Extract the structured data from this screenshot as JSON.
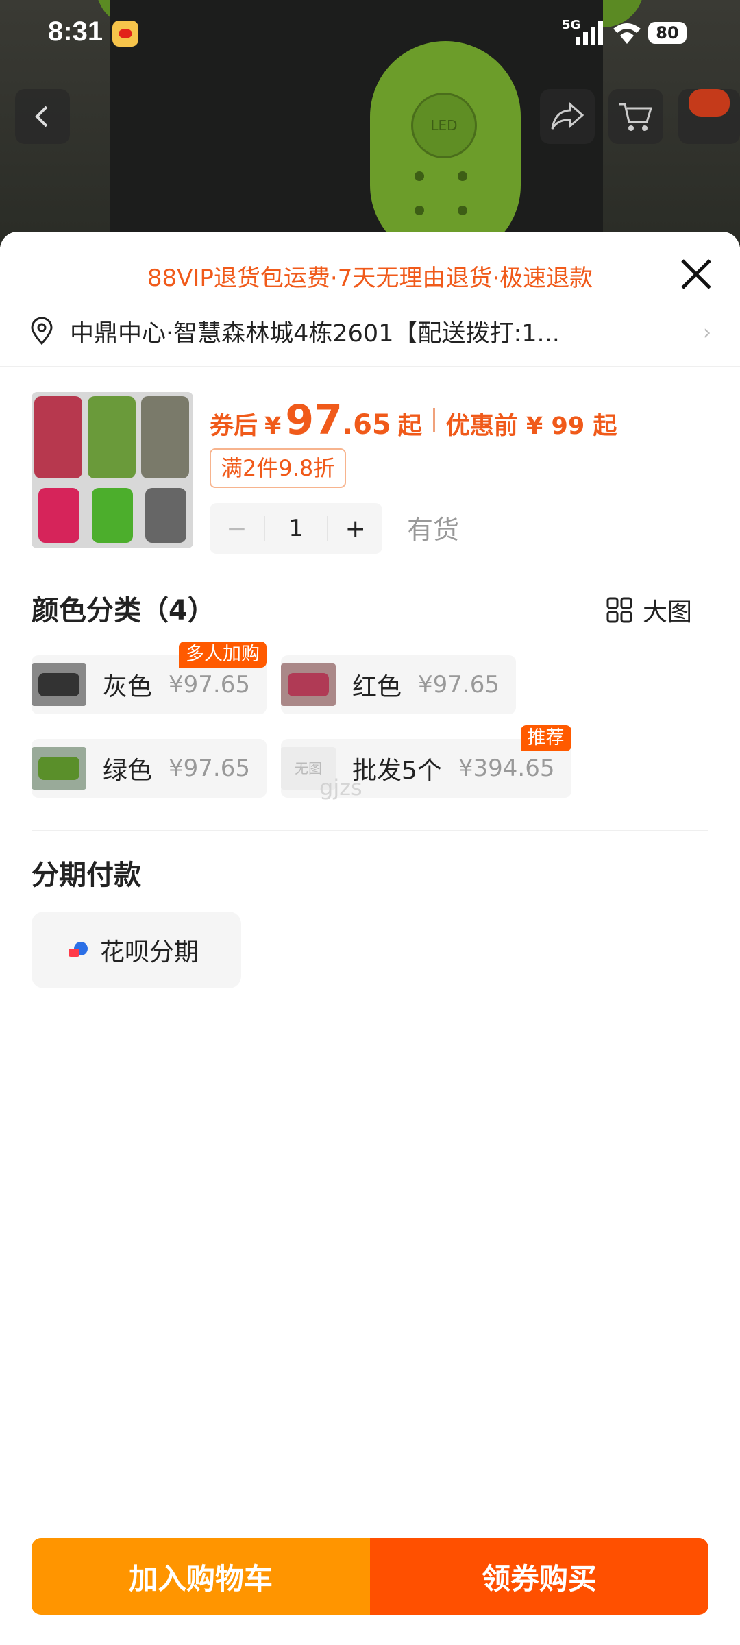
{
  "status_bar": {
    "time": "8:31",
    "network": "5G",
    "battery": "80"
  },
  "sheet": {
    "promo": "88VIP退货包运费·7天无理由退货·极速退款",
    "address": "中鼎中心·智慧森林城4栋2601【配送拨打:1...",
    "price": {
      "after_label": "券后",
      "currency": "¥",
      "after_int": "97",
      "after_dec": ".65",
      "suffix": "起",
      "before_text": "优惠前 ¥ 99 起"
    },
    "coupon": "满2件9.8折",
    "quantity": "1",
    "stock": "有货",
    "variants_title": "颜色分类（4）",
    "big_image": "大图",
    "variants": [
      {
        "name": "灰色",
        "price": "¥97.65",
        "badge": "多人加购"
      },
      {
        "name": "红色",
        "price": "¥97.65",
        "badge": ""
      },
      {
        "name": "绿色",
        "price": "¥97.65",
        "badge": ""
      },
      {
        "name": "批发5个",
        "price": "¥394.65",
        "badge": "推荐",
        "img_text": "无图"
      }
    ],
    "installment_title": "分期付款",
    "installment_option": "花呗分期",
    "watermark": "gjzs"
  },
  "cta": {
    "add_to_cart": "加入购物车",
    "buy": "领券购买"
  }
}
